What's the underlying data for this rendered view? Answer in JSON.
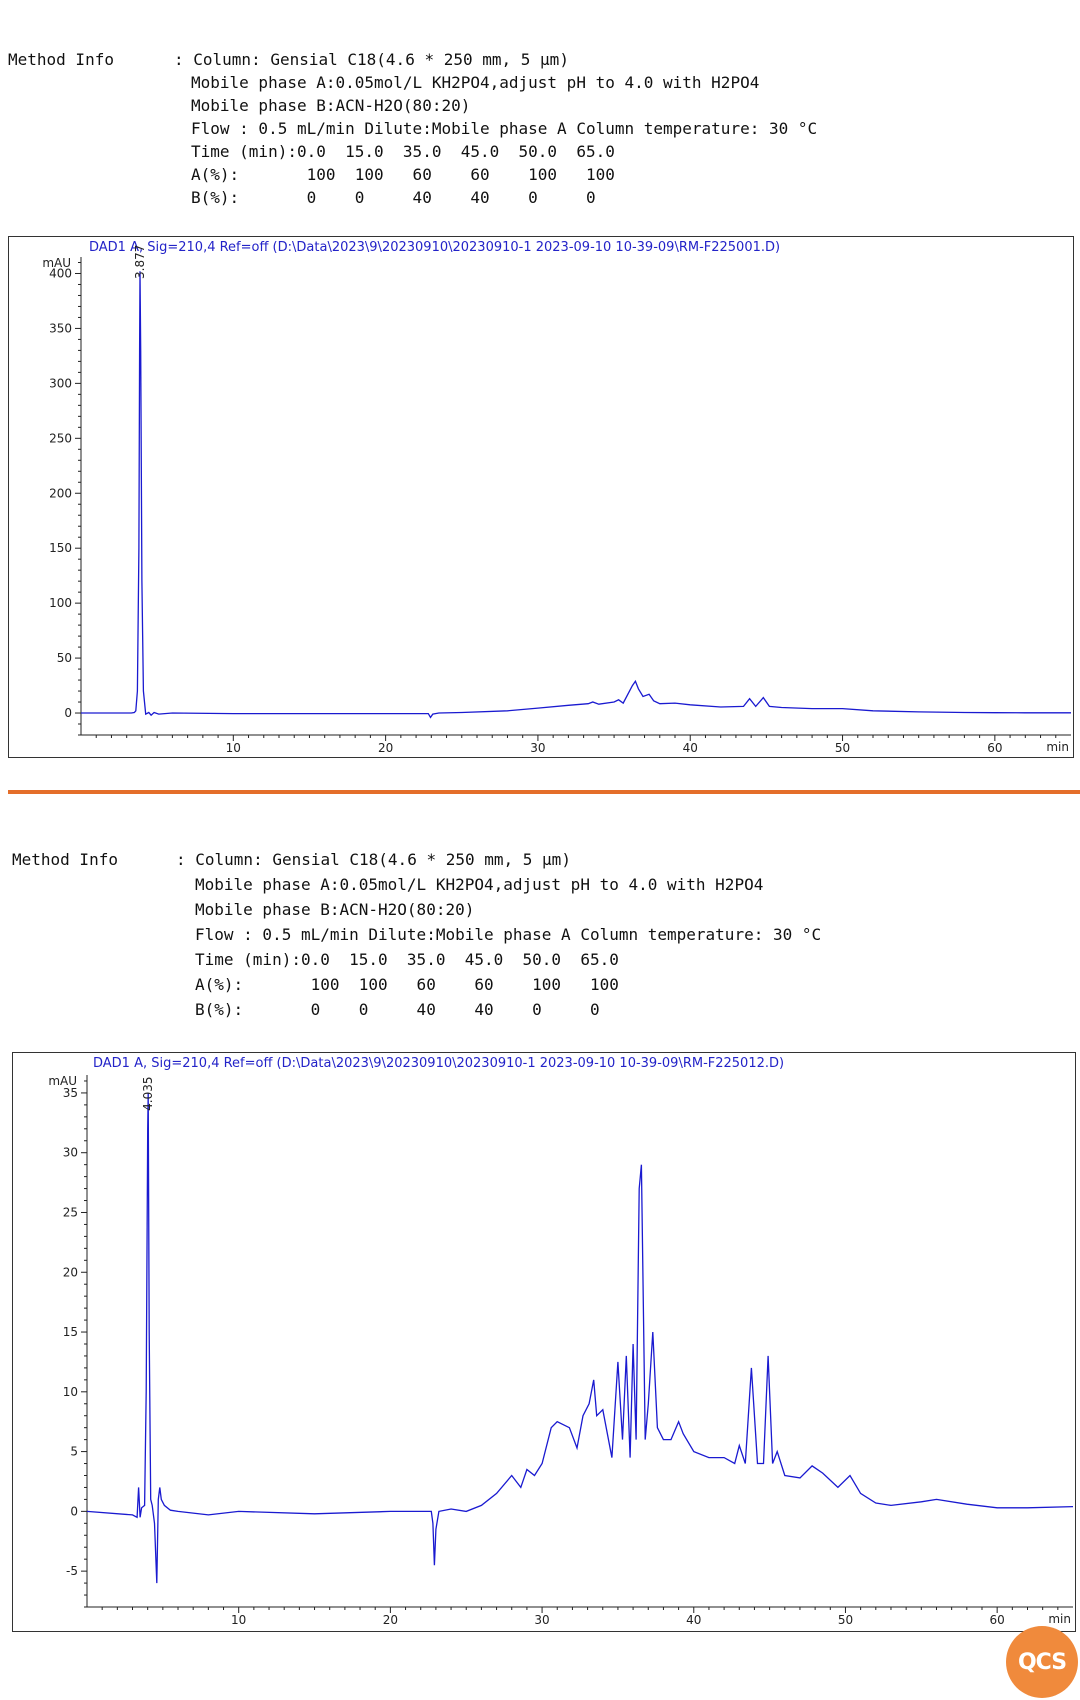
{
  "panels": [
    {
      "method_info": {
        "title": "Method Info",
        "lines": [
          ": Column: Gensial C18(4.6 * 250 mm, 5 μm)",
          "Mobile phase A:0.05mol/L KH2PO4,adjust pH to 4.0 with H2PO4",
          "Mobile phase B:ACN-H2O(80:20)",
          "Flow : 0.5 mL/min Dilute:Mobile phase A Column temperature: 30 °C",
          "Time (min):0.0  15.0  35.0  45.0  50.0  65.0",
          "A(%):       100  100   60    60    100   100",
          "B(%):       0    0     40    40    0     0"
        ]
      }
    },
    {
      "method_info": {
        "title": "Method Info",
        "lines": [
          ": Column: Gensial C18(4.6 * 250 mm, 5 μm)",
          "Mobile phase A:0.05mol/L KH2PO4,adjust pH to 4.0 with H2PO4",
          "Mobile phase B:ACN-H2O(80:20)",
          "Flow : 0.5 mL/min Dilute:Mobile phase A Column temperature: 30 °C",
          "Time (min):0.0  15.0  35.0  45.0  50.0  65.0",
          "A(%):       100  100   60    60    100   100",
          "B(%):       0    0     40    40    0     0"
        ]
      }
    }
  ],
  "logo_text": "QCS",
  "colors": {
    "trace": "#1a1ad0",
    "header_text": "#2323c8",
    "separator": "#e46e2a"
  },
  "chart_data": [
    {
      "type": "line",
      "title": "DAD1 A, Sig=210,4 Ref=off (D:\\Data\\2023\\9\\20230910\\20230910-1 2023-09-10 10-39-09\\RM-F225001.D)",
      "ylabel": "mAU",
      "xlabel": "min",
      "xlim": [
        0,
        65
      ],
      "ylim": [
        -20,
        415
      ],
      "xticks": [
        10,
        20,
        30,
        40,
        50,
        60
      ],
      "yticks": [
        0,
        50,
        100,
        150,
        200,
        250,
        300,
        350,
        400
      ],
      "grid": false,
      "peak_labels": [
        {
          "x": 3.877,
          "y": 395,
          "text": "3.877"
        }
      ],
      "series": [
        {
          "x": [
            0,
            3.3,
            3.5,
            3.6,
            3.7,
            3.8,
            3.85,
            3.877,
            3.92,
            4.0,
            4.1,
            4.25,
            4.45,
            4.6,
            4.8,
            5.1,
            6,
            10,
            15,
            20,
            22.8,
            22.95,
            23.1,
            23.5,
            25,
            28,
            30,
            32,
            33.3,
            33.6,
            34,
            35,
            35.3,
            35.6,
            36.2,
            36.4,
            36.6,
            36.9,
            37.3,
            37.6,
            38,
            39,
            40,
            42,
            43.5,
            43.9,
            44.3,
            44.8,
            45.2,
            46,
            48,
            50,
            52,
            55,
            58,
            60,
            62,
            65
          ],
          "y": [
            0,
            0,
            0.5,
            2,
            20,
            150,
            330,
            402,
            330,
            120,
            20,
            -1,
            0.5,
            -2,
            0.5,
            -1,
            0,
            -0.5,
            -0.5,
            -0.5,
            -0.5,
            -4,
            -1,
            0,
            0.5,
            2,
            4.5,
            7,
            8.5,
            10,
            8,
            10,
            12,
            9,
            25,
            29,
            22,
            15,
            17,
            11,
            8.5,
            9,
            7.5,
            5.5,
            6,
            13,
            6,
            14,
            6,
            5,
            4,
            4,
            2,
            1,
            0.5,
            0.3,
            0.2,
            0.2
          ]
        }
      ]
    },
    {
      "type": "line",
      "title": "DAD1 A, Sig=210,4 Ref=off (D:\\Data\\2023\\9\\20230910\\20230910-1 2023-09-10 10-39-09\\RM-F225012.D)",
      "ylabel": "mAU",
      "xlabel": "min",
      "xlim": [
        0,
        65
      ],
      "ylim": [
        -8,
        36.5
      ],
      "xticks": [
        10,
        20,
        30,
        40,
        50,
        60
      ],
      "yticks": [
        -5,
        0,
        5,
        10,
        15,
        20,
        25,
        30,
        35
      ],
      "grid": false,
      "peak_labels": [
        {
          "x": 4.035,
          "y": 33.5,
          "text": "4.035"
        }
      ],
      "series": [
        {
          "x": [
            0,
            3,
            3.3,
            3.4,
            3.5,
            3.6,
            3.8,
            3.9,
            4.0,
            4.035,
            4.1,
            4.2,
            4.3,
            4.45,
            4.6,
            4.7,
            4.8,
            4.9,
            5.1,
            5.5,
            6,
            8,
            10,
            15,
            20,
            22.7,
            22.8,
            22.9,
            23.0,
            23.2,
            24,
            25,
            26,
            27,
            28,
            28.6,
            29,
            29.5,
            30,
            30.6,
            31,
            31.8,
            32.3,
            32.7,
            33.1,
            33.4,
            33.6,
            34,
            34.6,
            35.0,
            35.3,
            35.55,
            35.8,
            36.0,
            36.2,
            36.4,
            36.55,
            36.8,
            37.0,
            37.3,
            37.6,
            38,
            38.5,
            39,
            39.3,
            40,
            41,
            42,
            42.7,
            43,
            43.4,
            43.8,
            44.2,
            44.6,
            44.9,
            45.2,
            45.5,
            46,
            47,
            47.8,
            48.5,
            49.5,
            50.3,
            51,
            52,
            53,
            55,
            56,
            58,
            60,
            62,
            65
          ],
          "y": [
            0,
            -0.3,
            -0.5,
            2,
            -0.5,
            0.3,
            0.5,
            10,
            32,
            35,
            15,
            1,
            0.5,
            -1,
            -6,
            1,
            2,
            1,
            0.5,
            0.1,
            0,
            -0.3,
            0,
            -0.2,
            0,
            0,
            -1,
            -4.5,
            -1.5,
            0,
            0.2,
            0,
            0.5,
            1.5,
            3,
            2,
            3.5,
            3,
            4,
            7,
            7.5,
            7,
            5.3,
            8,
            9,
            11,
            8,
            8.5,
            4.5,
            12.5,
            6,
            13,
            4.5,
            14,
            6,
            27,
            29,
            6,
            9,
            15,
            7,
            6,
            6,
            7.5,
            6.5,
            5,
            4.5,
            4.5,
            4,
            5.5,
            4,
            12,
            4,
            4,
            13,
            4,
            5,
            3,
            2.8,
            3.8,
            3.2,
            2,
            3,
            1.5,
            0.7,
            0.5,
            0.8,
            1,
            0.6,
            0.3,
            0.3,
            0.4
          ]
        }
      ]
    }
  ]
}
